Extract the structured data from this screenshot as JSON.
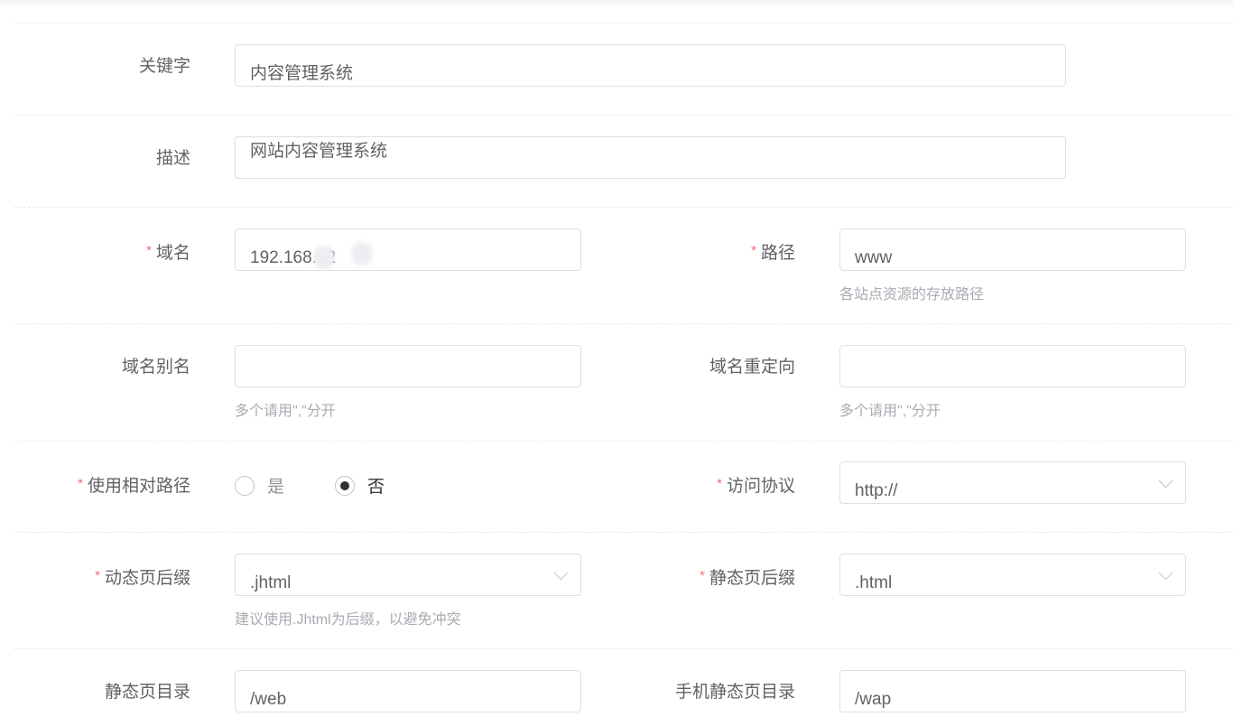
{
  "form": {
    "keywords": {
      "label": "关键字",
      "value": "内容管理系统"
    },
    "description": {
      "label": "描述",
      "value": "网站内容管理系统"
    },
    "domain": {
      "label": "域名",
      "value": "192.168.  .2"
    },
    "path": {
      "label": "路径",
      "value": "www",
      "hint": "各站点资源的存放路径"
    },
    "domain_alias": {
      "label": "域名别名",
      "value": "",
      "hint": "多个请用\",\"分开"
    },
    "domain_redirect": {
      "label": "域名重定向",
      "value": "",
      "hint": "多个请用\",\"分开"
    },
    "relative_path": {
      "label": "使用相对路径",
      "options": [
        "是",
        "否"
      ],
      "selected": "否"
    },
    "protocol": {
      "label": "访问协议",
      "value": "http://"
    },
    "dynamic_suffix": {
      "label": "动态页后缀",
      "value": ".jhtml",
      "hint": "建议使用.Jhtml为后缀，以避免冲突"
    },
    "static_suffix": {
      "label": "静态页后缀",
      "value": ".html"
    },
    "static_dir": {
      "label": "静态页目录",
      "value": "/web"
    },
    "mobile_static_dir": {
      "label": "手机静态页目录",
      "value": "/wap"
    }
  },
  "required_mark": "*"
}
